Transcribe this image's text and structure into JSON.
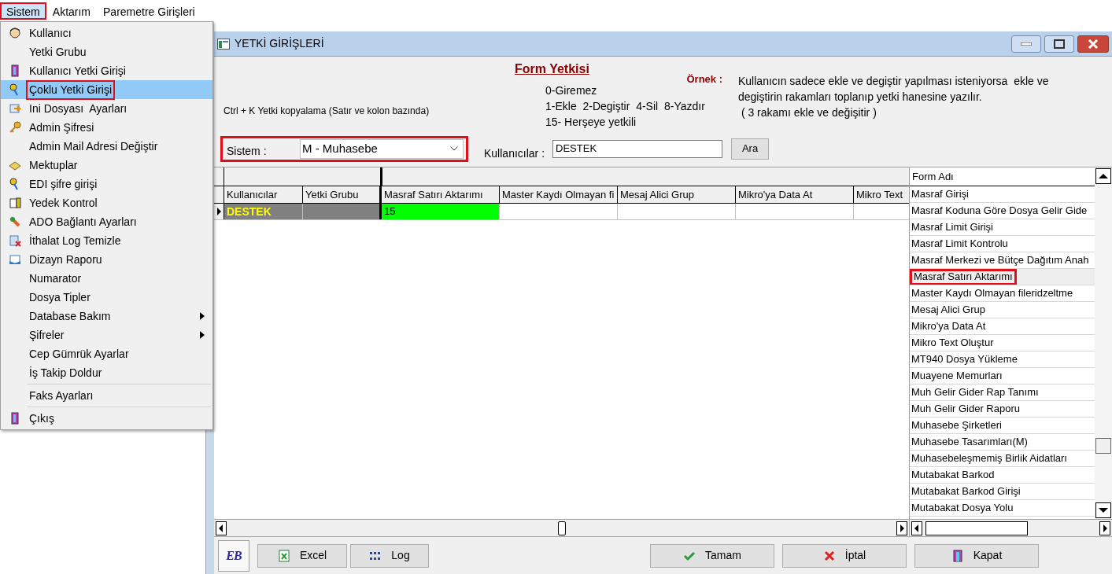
{
  "menubar": [
    {
      "label": "Sistem",
      "selected": true,
      "marked": true
    },
    {
      "label": "Aktarım",
      "selected": false,
      "marked": false
    },
    {
      "label": "Paremetre Girişleri",
      "selected": false,
      "marked": false
    }
  ],
  "menu": {
    "items": [
      {
        "label": "Kullanıcı",
        "kind": "icon",
        "selected": false,
        "marked": false,
        "separator_before": false
      },
      {
        "label": "Yetki Grubu",
        "kind": "plain",
        "selected": false,
        "marked": false,
        "separator_before": false
      },
      {
        "label": "Kullanıcı Yetki Girişi",
        "kind": "icon",
        "selected": false,
        "marked": false,
        "separator_before": false
      },
      {
        "label": "Çoklu Yetki Girişi",
        "kind": "icon",
        "selected": true,
        "marked": true,
        "separator_before": false
      },
      {
        "label": "Ini Dosyası  Ayarları",
        "kind": "icon",
        "selected": false,
        "marked": false,
        "separator_before": false
      },
      {
        "label": "Admin Şifresi",
        "kind": "icon",
        "selected": false,
        "marked": false,
        "separator_before": false
      },
      {
        "label": "Admin Mail Adresi Değiştir",
        "kind": "plain",
        "selected": false,
        "marked": false,
        "separator_before": false
      },
      {
        "label": "Mektuplar",
        "kind": "icon",
        "selected": false,
        "marked": false,
        "separator_before": false
      },
      {
        "label": "EDI şifre girişi",
        "kind": "icon",
        "selected": false,
        "marked": false,
        "separator_before": false
      },
      {
        "label": "Yedek Kontrol",
        "kind": "icon",
        "selected": false,
        "marked": false,
        "separator_before": false
      },
      {
        "label": "ADO Bağlantı Ayarları",
        "kind": "icon",
        "selected": false,
        "marked": false,
        "separator_before": false
      },
      {
        "label": "İthalat Log Temizle",
        "kind": "icon",
        "selected": false,
        "marked": false,
        "separator_before": false
      },
      {
        "label": "Dizayn Raporu",
        "kind": "icon",
        "selected": false,
        "marked": false,
        "separator_before": false
      },
      {
        "label": "Numarator",
        "kind": "plain",
        "selected": false,
        "marked": false,
        "separator_before": false
      },
      {
        "label": "Dosya Tipler",
        "kind": "plain",
        "selected": false,
        "marked": false,
        "separator_before": false
      },
      {
        "label": "Database Bakım",
        "kind": "submenu",
        "selected": false,
        "marked": false,
        "separator_before": false
      },
      {
        "label": "Şifreler",
        "kind": "submenu",
        "selected": false,
        "marked": false,
        "separator_before": false
      },
      {
        "label": "Cep Gümrük Ayarlar",
        "kind": "plain",
        "selected": false,
        "marked": false,
        "separator_before": false
      },
      {
        "label": "İş Takip Doldur",
        "kind": "plain",
        "selected": false,
        "marked": false,
        "separator_before": false
      },
      {
        "label": "Faks Ayarları",
        "kind": "plain",
        "selected": false,
        "marked": false,
        "separator_before": true
      },
      {
        "label": "Çıkış",
        "kind": "icon",
        "selected": false,
        "marked": false,
        "separator_before": true
      }
    ]
  },
  "window": {
    "title": "YETKİ GİRİŞLERİ"
  },
  "header": {
    "hint": "Ctrl + K Yetki kopyalama (Satır ve kolon bazında)",
    "title": "Form Yetkisi",
    "legend": [
      "0-Giremez",
      "1-Ekle  2-Degiştir  4-Sil  8-Yazdır",
      "15- Herşeye yetkili"
    ],
    "example_label": "Örnek :",
    "example_lines": [
      "Kullanıcın sadece ekle ve degiştir yapılması isteniyorsa  ekle ve",
      "degiştirin rakamları toplanıp yetki hanesine yazılır.",
      " ( 3 rakamı ekle ve değişitir )"
    ]
  },
  "sistem": {
    "label": "Sistem :",
    "value": "M - Muhasebe",
    "marked": true
  },
  "user_search": {
    "label": "Kullanıcılar :",
    "value": "DESTEK",
    "button": "Ara"
  },
  "grid": {
    "fixed_columns": [
      "Kullanıcılar",
      "Yetki Grubu"
    ],
    "columns": [
      "Masraf Satırı Aktarımı",
      "Master Kaydı Olmayan fi",
      "Mesaj Alici Grup",
      "Mikro'ya Data At",
      "Mikro Text"
    ],
    "rows": [
      {
        "user": "DESTEK",
        "current": true,
        "values": [
          {
            "text": "15",
            "selected": true
          }
        ]
      }
    ]
  },
  "form_list": {
    "header": "Form Adı",
    "items": [
      {
        "label": "Masraf Girişi",
        "selected": false,
        "marked": false
      },
      {
        "label": "Masraf Koduna Göre Dosya Gelir Gide",
        "selected": false,
        "marked": false
      },
      {
        "label": "Masraf Limit Girişi",
        "selected": false,
        "marked": false
      },
      {
        "label": "Masraf Limit Kontrolu",
        "selected": false,
        "marked": false
      },
      {
        "label": "Masraf Merkezi ve Bütçe Dağıtım Anah",
        "selected": false,
        "marked": false
      },
      {
        "label": "Masraf Satırı Aktarımı",
        "selected": true,
        "marked": true
      },
      {
        "label": "Master Kaydı Olmayan fileridzeltme",
        "selected": false,
        "marked": false
      },
      {
        "label": "Mesaj Alici Grup",
        "selected": false,
        "marked": false
      },
      {
        "label": "Mikro'ya Data At",
        "selected": false,
        "marked": false
      },
      {
        "label": "Mikro Text Oluştur",
        "selected": false,
        "marked": false
      },
      {
        "label": "MT940 Dosya Yükleme",
        "selected": false,
        "marked": false
      },
      {
        "label": "Muayene Memurları",
        "selected": false,
        "marked": false
      },
      {
        "label": "Muh Gelir Gider Rap Tanımı",
        "selected": false,
        "marked": false
      },
      {
        "label": "Muh Gelir Gider Raporu",
        "selected": false,
        "marked": false
      },
      {
        "label": "Muhasebe Şirketleri",
        "selected": false,
        "marked": false
      },
      {
        "label": "Muhasebe Tasarımları(M)",
        "selected": false,
        "marked": false
      },
      {
        "label": "Muhasebeleşmemiş Birlik Aidatları",
        "selected": false,
        "marked": false
      },
      {
        "label": "Mutabakat Barkod",
        "selected": false,
        "marked": false
      },
      {
        "label": "Mutabakat Barkod Girişi",
        "selected": false,
        "marked": false
      },
      {
        "label": "Mutabakat Dosya Yolu",
        "selected": false,
        "marked": false
      }
    ]
  },
  "logo": "EB",
  "buttons_left": [
    {
      "label": "Excel",
      "kind": "excel"
    },
    {
      "label": "Log",
      "kind": "log"
    }
  ],
  "buttons_right": [
    {
      "label": "Tamam",
      "kind": "ok"
    },
    {
      "label": "İptal",
      "kind": "cancel"
    },
    {
      "label": "Kapat",
      "kind": "close"
    }
  ]
}
